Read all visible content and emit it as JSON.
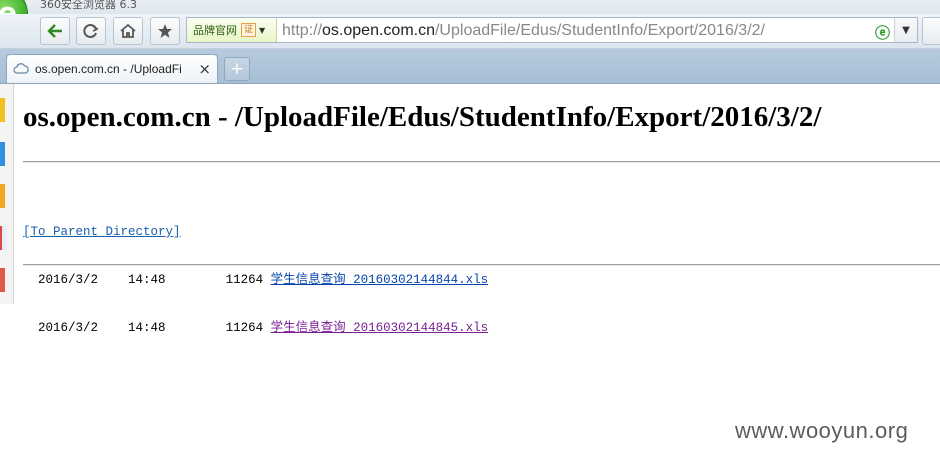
{
  "browser": {
    "app_title": "360安全浏览器 6.3",
    "badge_label": "品牌官网",
    "badge_cert": "证",
    "url_scheme": "http://",
    "url_host_pre": "os.",
    "url_host_domain": "open.com.cn",
    "url_path": "/UploadFile/Edus/StudentInfo/Export/2016/3/2/",
    "tab_title": "os.open.com.cn - /UploadFi",
    "tab_close": "×",
    "new_tab": "+"
  },
  "page": {
    "title": "os.open.com.cn - /UploadFile/Edus/StudentInfo/Export/2016/3/2/",
    "parent_link": "[To Parent Directory]",
    "files": [
      {
        "date": "2016/3/2",
        "time": "14:48",
        "size": "11264",
        "name": "学生信息查询_20160302144844.xls"
      },
      {
        "date": "2016/3/2",
        "time": "14:48",
        "size": "11264",
        "name": "学生信息查询_20160302144845.xls"
      }
    ]
  },
  "watermark": "www.wooyun.org",
  "colors": {
    "link": "#0645ad",
    "visited_link": "#7a1f93",
    "tabbar": "#a7bed4",
    "logo_green": "#3fb12c"
  },
  "icons": [
    "browser-logo-icon",
    "back-arrow-icon",
    "refresh-icon",
    "home-icon",
    "star-icon",
    "cloud-icon",
    "ie-compat-icon",
    "dropdown-icon"
  ]
}
